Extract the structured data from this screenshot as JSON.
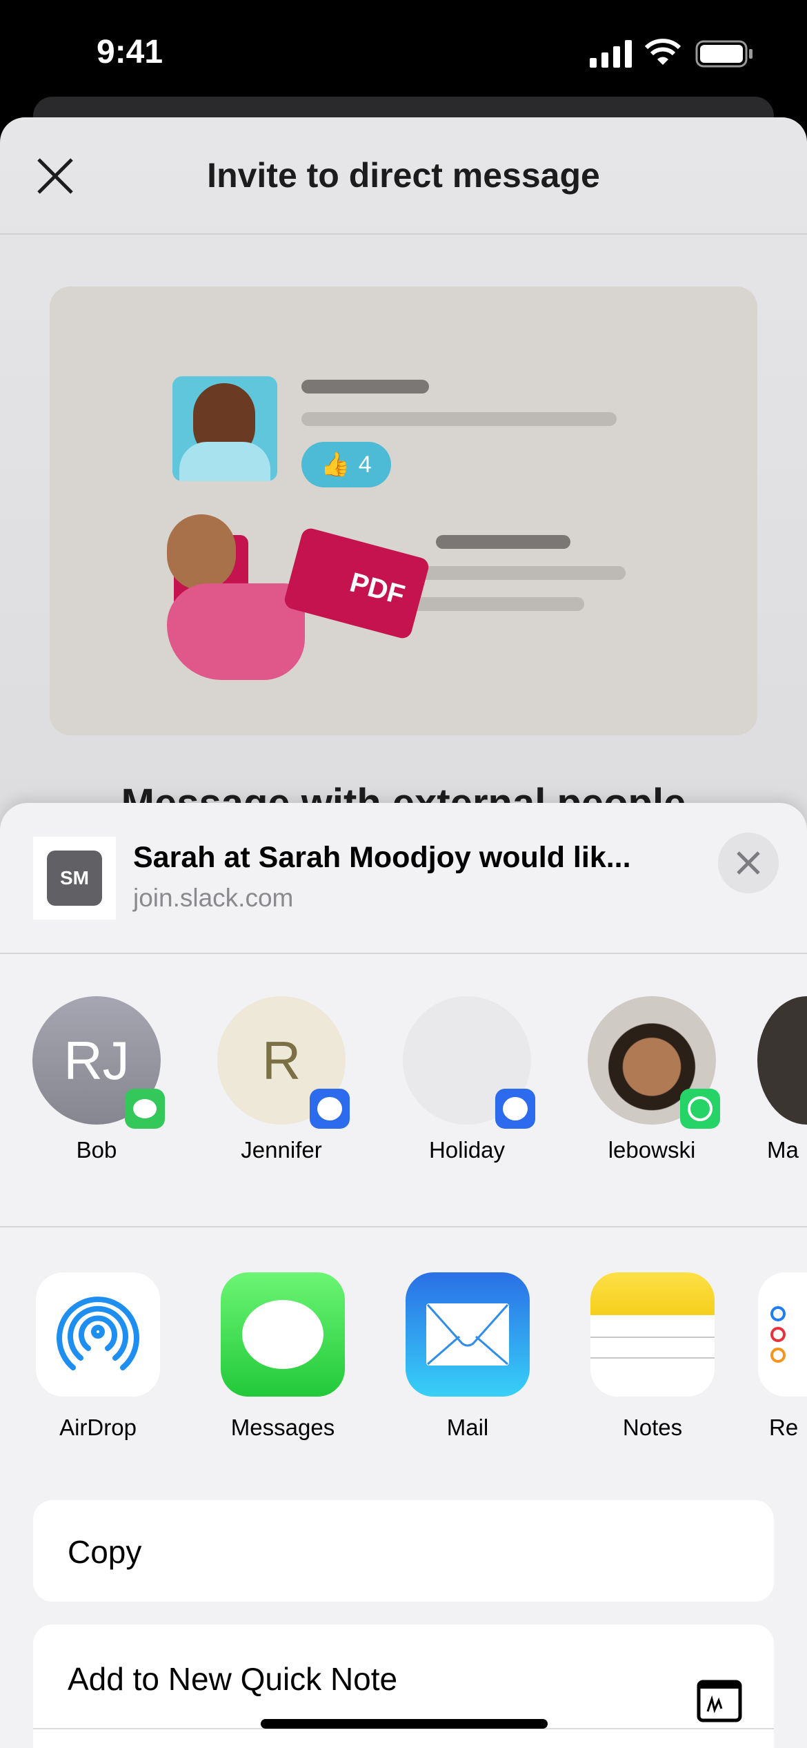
{
  "status_bar": {
    "time": "9:41"
  },
  "background": {
    "header_title": "Invite to direct message",
    "heading": "Message with external people",
    "illustration": {
      "reaction_count": "4",
      "file_label": "PDF"
    }
  },
  "share_sheet": {
    "thumbnail_initials": "SM",
    "title": "Sarah at Sarah Moodjoy would lik...",
    "subtitle": "join.slack.com",
    "contacts": [
      {
        "name": "Bob",
        "initials": "RJ",
        "app": "messages-icon"
      },
      {
        "name": "Jennifer",
        "initials": "R",
        "app": "signal-icon"
      },
      {
        "name": "Holiday",
        "initials": "",
        "app": "signal-icon"
      },
      {
        "name": "lebowski",
        "initials": "",
        "app": "whatsapp-icon"
      },
      {
        "name": "Ma",
        "initials": "",
        "app": ""
      }
    ],
    "apps": [
      {
        "name": "AirDrop"
      },
      {
        "name": "Messages"
      },
      {
        "name": "Mail"
      },
      {
        "name": "Notes"
      },
      {
        "name": "Re"
      }
    ],
    "actions": [
      {
        "label": "Copy"
      },
      {
        "label": "Add to New Quick Note",
        "icon": "quick-note-icon"
      }
    ]
  }
}
